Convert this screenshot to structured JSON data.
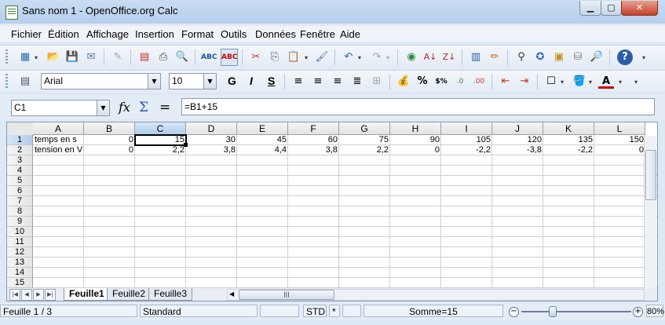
{
  "window": {
    "title": "Sans nom 1 - OpenOffice.org Calc"
  },
  "menu": [
    "Fichier",
    "Édition",
    "Affichage",
    "Insertion",
    "Format",
    "Outils",
    "Données",
    "Fenêtre",
    "Aide"
  ],
  "format_toolbar": {
    "font_name": "Arial",
    "font_size": "10",
    "bold": "G",
    "italic": "I",
    "underline": "S"
  },
  "formula_bar": {
    "name_box": "C1",
    "formula": "=B1+15"
  },
  "sheet": {
    "columns": [
      "A",
      "B",
      "C",
      "D",
      "E",
      "F",
      "G",
      "H",
      "I",
      "J",
      "K",
      "L"
    ],
    "rows": [
      "1",
      "2",
      "3",
      "4",
      "5",
      "6",
      "7",
      "8",
      "9",
      "10",
      "11",
      "12",
      "13",
      "14",
      "15"
    ],
    "data": [
      [
        "temps en s",
        "0",
        "15",
        "30",
        "45",
        "60",
        "75",
        "90",
        "105",
        "120",
        "135",
        "150"
      ],
      [
        "tension en V",
        "0",
        "2,2",
        "3,8",
        "4,4",
        "3,8",
        "2,2",
        "0",
        "-2,2",
        "-3,8",
        "-2,2",
        "0"
      ]
    ],
    "selected_cell": "C1",
    "tabs": [
      "Feuille1",
      "Feuille2",
      "Feuille3"
    ],
    "active_tab": "Feuille1"
  },
  "status": {
    "sheet_info": "Feuille 1 / 3",
    "style": "Standard",
    "mode": "STD",
    "modified": "*",
    "sum": "Somme=15",
    "zoom": "80%"
  },
  "colors": {
    "selection": "#b4cdeb",
    "title_bar": "#c9dcf2"
  },
  "icons": [
    "new-icon",
    "open-icon",
    "save-icon",
    "mail-icon",
    "edit-icon",
    "pdf-icon",
    "print-icon",
    "preview-icon",
    "spellcheck-icon",
    "autospell-icon",
    "cut-icon",
    "copy-icon",
    "paste-icon",
    "clone-format-icon",
    "undo-icon",
    "redo-icon",
    "navigator-icon",
    "sort-asc-icon",
    "sort-desc-icon",
    "chart-icon",
    "draw-icon",
    "find-icon",
    "gallery-icon",
    "datasource-icon",
    "zoom-icon",
    "help-icon"
  ]
}
